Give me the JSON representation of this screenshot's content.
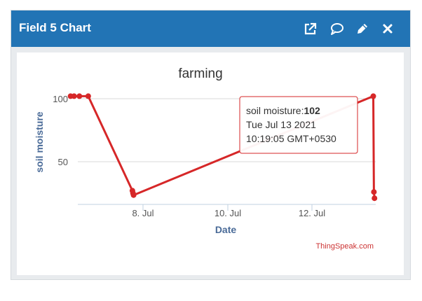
{
  "widget": {
    "title": "Field 5 Chart",
    "icons": [
      "external-link-icon",
      "comment-icon",
      "pencil-icon",
      "close-icon"
    ]
  },
  "chart_data": {
    "type": "line",
    "title": "farming",
    "xlabel": "Date",
    "ylabel": "soil moisture",
    "x_tick_labels": [
      "8. Jul",
      "10. Jul",
      "12. Jul"
    ],
    "y_tick_labels": [
      "50",
      "100"
    ],
    "ylim": [
      18,
      104
    ],
    "grid": true,
    "color": "#d62728",
    "series": [
      {
        "points": [
          [
            "2021-07-06 07:00",
            102
          ],
          [
            "2021-07-06 09:00",
            102
          ],
          [
            "2021-07-06 12:00",
            102
          ],
          [
            "2021-07-06 17:00",
            102
          ],
          [
            "2021-07-07 18:00",
            27
          ],
          [
            "2021-07-07 18:20",
            25
          ],
          [
            "2021-07-07 18:40",
            23.5
          ],
          [
            "2021-07-13 10:19",
            102
          ],
          [
            "2021-07-13 10:40",
            26
          ],
          [
            "2021-07-13 11:00",
            21
          ]
        ]
      }
    ],
    "tooltip": {
      "label": "soil moisture:",
      "value": "102",
      "date": "Tue Jul 13 2021",
      "time": "10:19:05 GMT+0530"
    },
    "credit": "ThingSpeak.com"
  }
}
